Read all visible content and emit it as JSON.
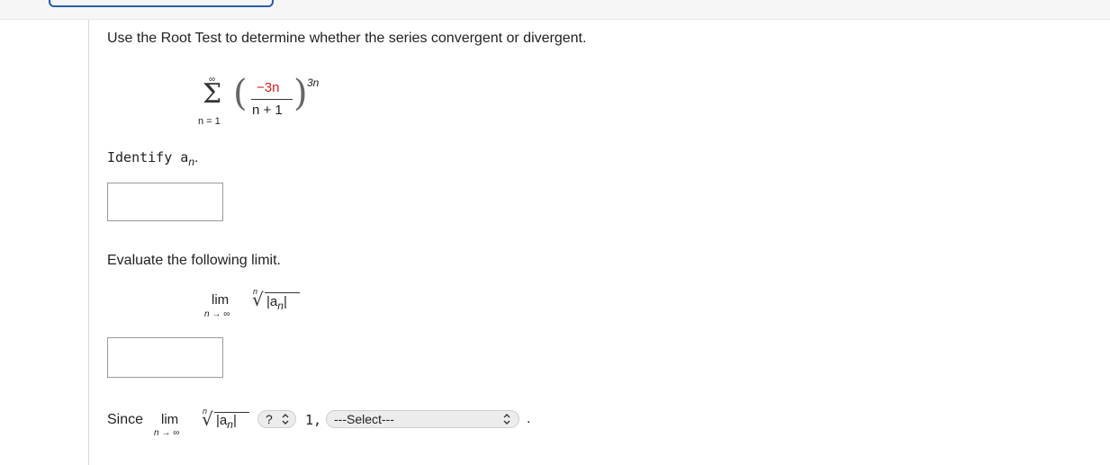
{
  "question": {
    "instruction": "Use the Root Test to determine whether the series convergent or divergent.",
    "series": {
      "sum_upper": "∞",
      "sum_lower": "n = 1",
      "numerator": "−3n",
      "denominator": "n + 1",
      "exponent": "3n"
    }
  },
  "identify": {
    "label": "Identify a",
    "subscript": "n",
    "suffix": ".",
    "input_value": ""
  },
  "limit": {
    "label": "Evaluate the following limit.",
    "lim": "lim",
    "under": "n → ∞",
    "root_index": "n",
    "radicand": "|a",
    "radicand_sub": "n",
    "radicand_close": "|",
    "input_value": ""
  },
  "conclusion": {
    "since": "Since",
    "lim": "lim",
    "under": "n → ∞",
    "root_index": "n",
    "radicand": "|a",
    "radicand_sub": "n",
    "radicand_close": "|",
    "compare_value": "?",
    "one": "1,",
    "result_value": "---Select---",
    "end": "."
  },
  "colors": {
    "accent_blue": "#2a5ea8",
    "red_math": "#cc1f1f"
  }
}
